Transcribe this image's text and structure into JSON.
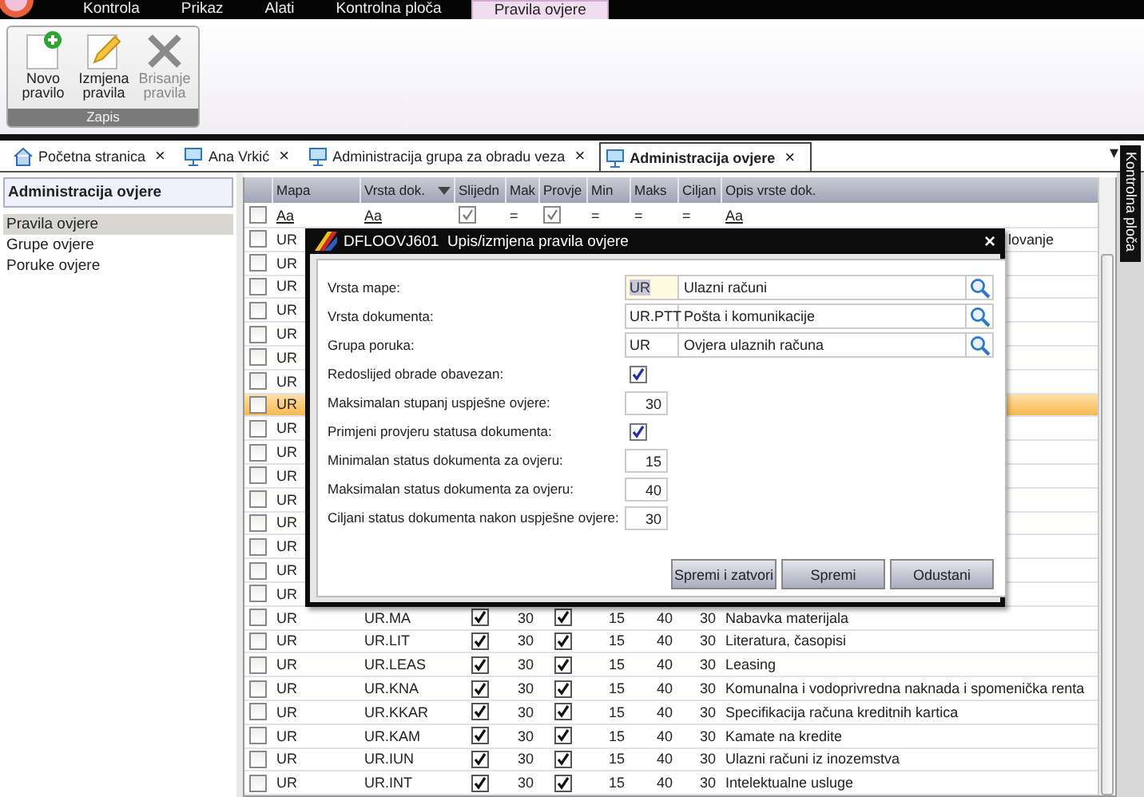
{
  "menu": [
    {
      "label": "Kontrola",
      "selected": false
    },
    {
      "label": "Prikaz",
      "selected": false
    },
    {
      "label": "Alati",
      "selected": false
    },
    {
      "label": "Kontrolna ploča",
      "selected": false
    },
    {
      "label": "Pravila ovjere",
      "selected": true
    }
  ],
  "ribbon": {
    "group": "Zapis",
    "buttons": [
      {
        "kind": "new",
        "label": "Novo pravilo",
        "disabled": false
      },
      {
        "kind": "edit",
        "label": "Izmjena pravila",
        "disabled": false
      },
      {
        "kind": "delete",
        "label": "Brisanje pravila",
        "disabled": true
      }
    ]
  },
  "tabs": [
    {
      "kind": "home",
      "label": "Početna stranica",
      "selected": false
    },
    {
      "kind": "screen",
      "label": "Ana Vrkić",
      "selected": false
    },
    {
      "kind": "screen",
      "label": "Administracija grupa za obradu veza",
      "selected": false
    },
    {
      "kind": "screen",
      "label": "Administracija ovjere",
      "selected": true
    }
  ],
  "tab_menu": "▾",
  "tab_close": "×",
  "sidebar": {
    "title": "Administracija ovjere",
    "items": [
      {
        "label": "Pravila ovjere",
        "selected": true
      },
      {
        "label": "Grupe ovjere",
        "selected": false
      },
      {
        "label": "Poruke ovjere",
        "selected": false
      }
    ]
  },
  "side_panel": "Kontrolna ploča",
  "table": {
    "columns": [
      "Mapa",
      "Vrsta dok.",
      "Slijedn",
      "Mak",
      "Provje",
      "Min",
      "Maks",
      "Ciljan",
      "Opis vrste dok."
    ],
    "select_all": {
      "checked": false
    },
    "filters": [
      {
        "kind": "text",
        "label": "Aa"
      },
      {
        "kind": "text",
        "label": "Aa"
      },
      {
        "kind": "check",
        "checked": true
      },
      {
        "kind": "text",
        "label": "="
      },
      {
        "kind": "check",
        "checked": true
      },
      {
        "kind": "text",
        "label": "="
      },
      {
        "kind": "text",
        "label": "="
      },
      {
        "kind": "text",
        "label": "="
      },
      {
        "kind": "text",
        "label": "Aa"
      }
    ],
    "rows": [
      {
        "checked": false,
        "selected": false,
        "mapa": "UR",
        "opis": "lovanje",
        "cut": true
      },
      {
        "checked": false,
        "selected": false,
        "mapa": "UR"
      },
      {
        "checked": false,
        "selected": false,
        "mapa": "UR"
      },
      {
        "checked": false,
        "selected": false,
        "mapa": "UR"
      },
      {
        "checked": false,
        "selected": false,
        "mapa": "UR"
      },
      {
        "checked": false,
        "selected": false,
        "mapa": "UR"
      },
      {
        "checked": false,
        "selected": false,
        "mapa": "UR"
      },
      {
        "checked": false,
        "selected": true,
        "mapa": "UR"
      },
      {
        "checked": false,
        "selected": false,
        "mapa": "UR"
      },
      {
        "checked": false,
        "selected": false,
        "mapa": "UR"
      },
      {
        "checked": false,
        "selected": false,
        "mapa": "UR"
      },
      {
        "checked": false,
        "selected": false,
        "mapa": "UR"
      },
      {
        "checked": false,
        "selected": false,
        "mapa": "UR"
      },
      {
        "checked": false,
        "selected": false,
        "mapa": "UR"
      },
      {
        "checked": false,
        "selected": false,
        "mapa": "UR"
      },
      {
        "checked": false,
        "selected": false,
        "mapa": "UR"
      },
      {
        "checked": false,
        "selected": false,
        "mapa": "UR",
        "vrsta": "UR.MA",
        "slijedni": true,
        "maks": "30",
        "provjera": true,
        "min": "15",
        "max_status": "40",
        "ciljani": "30",
        "opis": "Nabavka materijala"
      },
      {
        "checked": false,
        "selected": false,
        "mapa": "UR",
        "vrsta": "UR.LIT",
        "slijedni": true,
        "maks": "30",
        "provjera": true,
        "min": "15",
        "max_status": "40",
        "ciljani": "30",
        "opis": "Literatura, časopisi"
      },
      {
        "checked": false,
        "selected": false,
        "mapa": "UR",
        "vrsta": "UR.LEAS",
        "slijedni": true,
        "maks": "30",
        "provjera": true,
        "min": "15",
        "max_status": "40",
        "ciljani": "30",
        "opis": "Leasing"
      },
      {
        "checked": false,
        "selected": false,
        "mapa": "UR",
        "vrsta": "UR.KNA",
        "slijedni": true,
        "maks": "30",
        "provjera": true,
        "min": "15",
        "max_status": "40",
        "ciljani": "30",
        "opis": "Komunalna i vodoprivredna naknada i spomenička renta"
      },
      {
        "checked": false,
        "selected": false,
        "mapa": "UR",
        "vrsta": "UR.KKAR",
        "slijedni": true,
        "maks": "30",
        "provjera": true,
        "min": "15",
        "max_status": "40",
        "ciljani": "30",
        "opis": "Specifikacija računa kreditnih kartica"
      },
      {
        "checked": false,
        "selected": false,
        "mapa": "UR",
        "vrsta": "UR.KAM",
        "slijedni": true,
        "maks": "30",
        "provjera": true,
        "min": "15",
        "max_status": "40",
        "ciljani": "30",
        "opis": "Kamate na kredite"
      },
      {
        "checked": false,
        "selected": false,
        "mapa": "UR",
        "vrsta": "UR.IUN",
        "slijedni": true,
        "maks": "30",
        "provjera": true,
        "min": "15",
        "max_status": "40",
        "ciljani": "30",
        "opis": "Ulazni računi iz inozemstva"
      },
      {
        "checked": false,
        "selected": false,
        "mapa": "UR",
        "vrsta": "UR.INT",
        "slijedni": true,
        "maks": "30",
        "provjera": true,
        "min": "15",
        "max_status": "40",
        "ciljani": "30",
        "opis": "Intelektualne usluge"
      }
    ]
  },
  "dialog": {
    "code": "DFLOOVJ601",
    "title": "Upis/izmjena pravila ovjere",
    "close": "×",
    "fields": [
      {
        "kind": "lookup",
        "label": "Vrsta mape:",
        "code": "UR",
        "value": "Ulazni računi",
        "focused": true
      },
      {
        "kind": "lookup",
        "label": "Vrsta dokumenta:",
        "code": "UR.PTT",
        "value": "Pošta i komunikacije",
        "focused": false
      },
      {
        "kind": "lookup",
        "label": "Grupa poruka:",
        "code": "UR",
        "value": "Ovjera ulaznih računa",
        "focused": false
      },
      {
        "kind": "checkbox",
        "label": "Redoslijed obrade obavezan:",
        "checked": true
      },
      {
        "kind": "number",
        "label": "Maksimalan stupanj uspješne ovjere:",
        "value": "30"
      },
      {
        "kind": "checkbox",
        "label": "Primjeni provjeru statusa dokumenta:",
        "checked": true
      },
      {
        "kind": "number",
        "label": "Minimalan status dokumenta za ovjeru:",
        "value": "15"
      },
      {
        "kind": "number",
        "label": "Maksimalan status dokumenta za ovjeru:",
        "value": "40"
      },
      {
        "kind": "number",
        "label": "Ciljani status dokumenta nakon uspješne ovjere:",
        "value": "30"
      }
    ],
    "buttons": [
      "Spremi i zatvori",
      "Spremi",
      "Odustani"
    ]
  }
}
